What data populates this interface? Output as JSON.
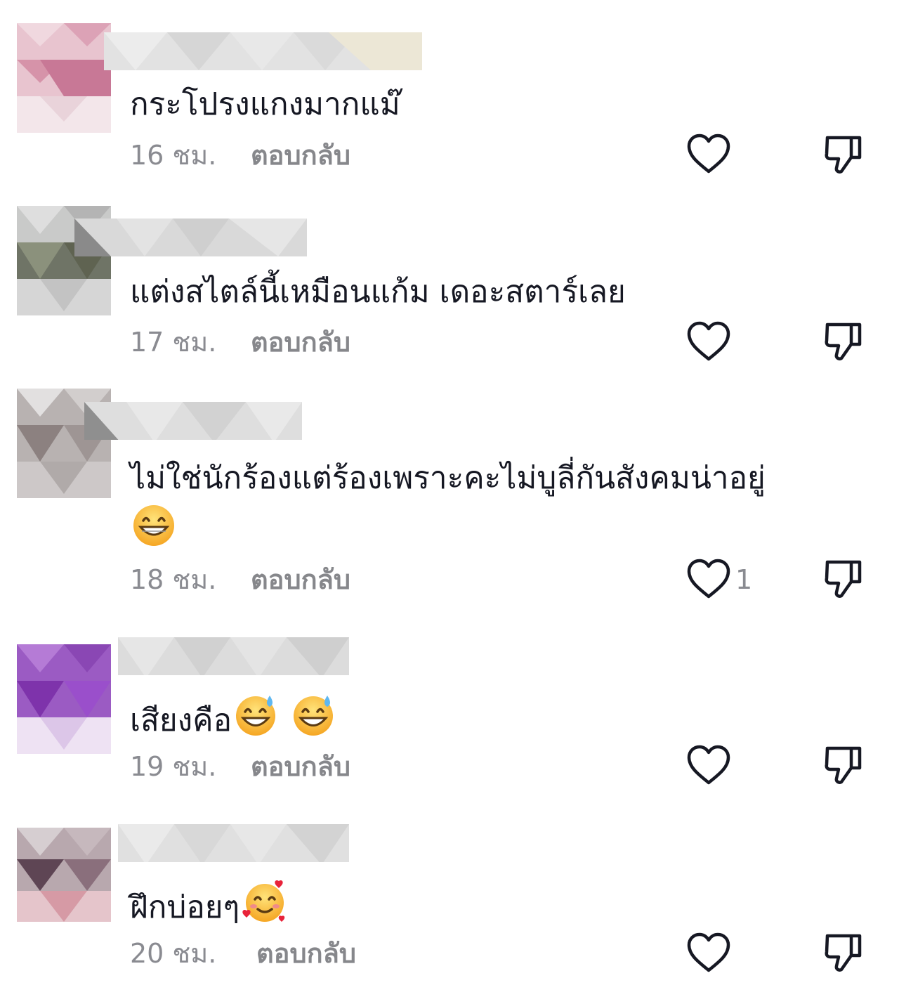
{
  "comments": [
    {
      "text": "กระโปรงแกงมากแม๊",
      "emojis": [],
      "time": "16 ชม.",
      "reply_label": "ตอบกลับ",
      "likes": ""
    },
    {
      "text": "แต่งสไตล์นี้เหมือนแก้ม เดอะสตาร์เลย",
      "emojis": [],
      "time": "17 ชม.",
      "reply_label": "ตอบกลับ",
      "likes": ""
    },
    {
      "text": "ไม่ใช่นักร้องแต่ร้องเพราะคะไม่บูลี่กันสังคมน่าอยู่",
      "emojis": [
        "grinning-face-emoji"
      ],
      "time": "18 ชม.",
      "reply_label": "ตอบกลับ",
      "likes": "1"
    },
    {
      "text": "เสียงคือ",
      "emojis": [
        "sweat-smile-emoji",
        "sweat-smile-emoji"
      ],
      "time": "19 ชม.",
      "reply_label": "ตอบกลับ",
      "likes": ""
    },
    {
      "text": "ฝึกบ่อยๆ",
      "emojis": [
        "smiling-face-with-hearts-emoji"
      ],
      "time": "20 ชม.",
      "reply_label": "ตอบกลับ",
      "likes": ""
    }
  ],
  "icons": {
    "like": "heart-outline-icon",
    "dislike": "thumbs-down-outline-icon"
  },
  "colors": {
    "text": "#161823",
    "meta": "#8a8b91",
    "icon": "#161823"
  }
}
